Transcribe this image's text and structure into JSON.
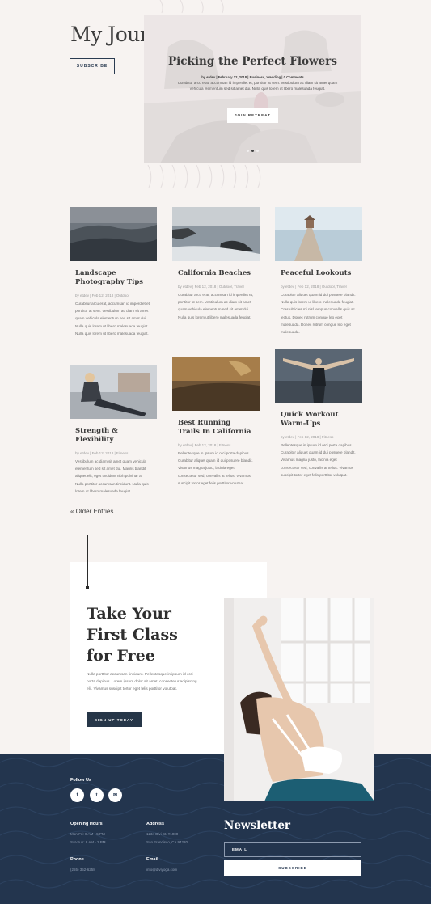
{
  "header": {
    "title": "My Journal",
    "subscribe_label": "SUBSCRIBE"
  },
  "hero": {
    "title": "Picking the Perfect Flowers",
    "meta": "by etdev | February 12, 2018 | Business, Wedding | 0 Comments",
    "excerpt": "Curabitur arcu erat, accumsan id imperdiet et, porttitor at sem. Vestibulum ac diam sit amet quam vehicula elementum sed sit amet dui. Nulla quis lorem ut libero malesuada feugiat.",
    "button_label": "JOIN RETREAT",
    "slide_count": 3,
    "active_slide": 2
  },
  "posts": [
    {
      "title": "Landscape Photography Tips",
      "meta": "by etdev | Feb 12, 2018 | Outdoor",
      "excerpt": "Curabitur arcu erat, accumsan id imperdiet et, porttitor at sem. Vestibulum ac diam sit amet quam vehicula elementum sed sit amet dui. Nulla quis lorem ut libero malesuada feugiat. Nulla quis lorem ut libero malesuada feugiat."
    },
    {
      "title": "California Beaches",
      "meta": "by etdev | Feb 12, 2018 | Outdoor, Travel",
      "excerpt": "Curabitur arcu erat, accumsan id imperdiet et, porttitor at sem. Vestibulum ac diam sit amet quam vehicula elementum sed sit amet dui. Nulla quis lorem ut libero malesuada feugiat."
    },
    {
      "title": "Peaceful Lookouts",
      "meta": "by etdev | Feb 12, 2018 | Outdoor, Travel",
      "excerpt": "Curabitur aliquet quam id dui posuere blandit. Nulla quis lorem ut libero malesuada feugiat. Cras ultricies mi nisl tempus convallis quis ac lectus. Donec rutrum congue leo eget malesuada. Donec rutrum congue leo eget malesuada."
    },
    {
      "title": "Strength & Flexibility",
      "meta": "by etdev | Feb 12, 2018 | Fitness",
      "excerpt": "Vestibulum ac diam sit amet quam vehicula elementum sed sit amet dui. Mauris blandit aliquet elit, eget tincidunt nibh pulvinar a. Nulla porttitor accumsan tincidunt. Nulla quis lorem ut libero malesuada feugiat."
    },
    {
      "title": "Best Running Trails In California",
      "meta": "by etdev | Feb 12, 2018 | Fitness",
      "excerpt": "Pellentesque in ipsum id orci porta dapibus. Curabitur aliquet quam id dui posuere blandit. Vivamus magna justo, lacinia eget consectetur sed, convallis at tellus. Vivamus suscipit tortor eget felis porttitor volutpat."
    },
    {
      "title": "Quick Workout Warm-Ups",
      "meta": "by etdev | Feb 12, 2018 | Fitness",
      "excerpt": "Pellentesque in ipsum id orci porta dapibus. Curabitur aliquet quam id dui posuere blandit. Vivamus magna justo, lacinia eget consectetur sed, convallis at tellus. Vivamus suscipit tortor eget felis porttitor volutpat."
    }
  ],
  "pagination": {
    "older_label": "« Older Entries"
  },
  "cta": {
    "title": "Take Your First Class for Free",
    "text": "Nulla porttitor accumsan tincidunt. Pellentesque in ipsum id orci porta dapibus. Lorem ipsum dolor sit amet, consectetur adipiscing elit. Vivamus suscipit tortor eget felis porttitor volutpat.",
    "button_label": "SIGN UP TODAY"
  },
  "footer": {
    "follow_label": "Follow Us",
    "social": [
      {
        "icon": "facebook-icon",
        "glyph": "f"
      },
      {
        "icon": "twitter-icon",
        "glyph": "t"
      },
      {
        "icon": "email-icon",
        "glyph": "✉"
      }
    ],
    "hours_label": "Opening Hours",
    "hours_line1": "Mon-Fri: 8 AM - 5 PM",
    "hours_line2": "Sat-Sun: 8 AM - 2 PM",
    "address_label": "Address",
    "address_line1": "1234 Divi St. #1000",
    "address_line2": "San Francisco, CA 94220",
    "phone_label": "Phone",
    "phone_value": "(255) 352-6258",
    "email_label": "Email",
    "email_value": "info@diviyoga.com",
    "newsletter_title": "Newsletter",
    "email_placeholder": "EMAIL",
    "newsletter_button": "SUBSCRIBE"
  },
  "colors": {
    "background": "#f7f3f1",
    "navy": "#23354e",
    "button_dark": "#263648",
    "heading": "#3a3a3a"
  }
}
